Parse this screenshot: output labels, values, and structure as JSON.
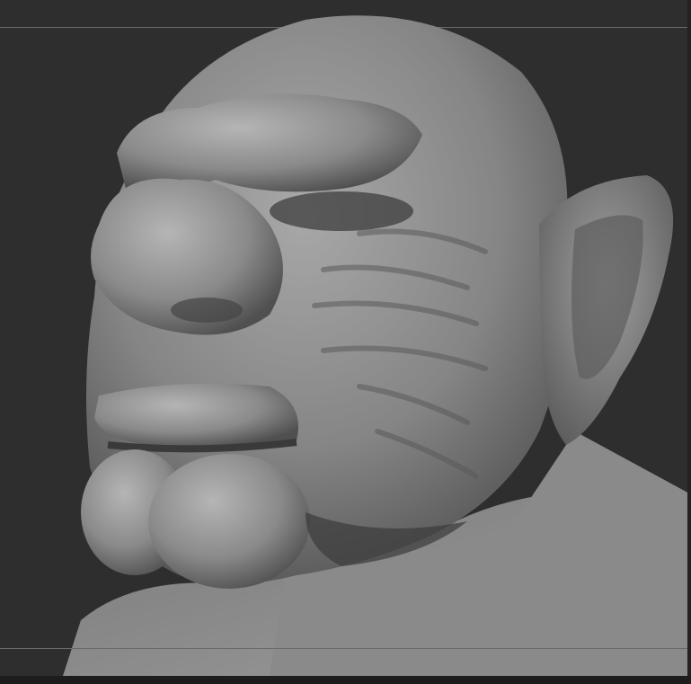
{
  "viewport": {
    "background_color": "#2e2e2e",
    "frame_line_color": "#6a6a6a",
    "bottom_bar_color": "#1d1d1d"
  },
  "canvas": {
    "subject": "sculpt-mesh",
    "material_color": "#8c8c8c",
    "highlight_color": "#b8b8b8",
    "shadow_color": "#3a3a3a"
  }
}
